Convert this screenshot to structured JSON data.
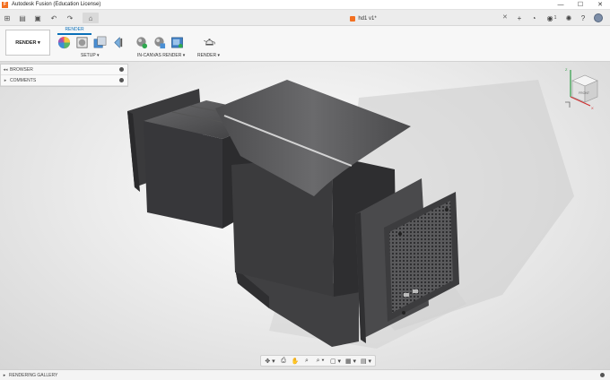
{
  "titlebar": {
    "title": "Autodesk Fusion (Education License)",
    "app_icon_letter": "F",
    "minimize": "—",
    "maximize": "☐",
    "close": "✕"
  },
  "tabbar": {
    "grid_icon": "⊞",
    "file_icon": "▤",
    "save_icon": "▣",
    "undo_icon": "↶",
    "redo_icon": "↷",
    "home_icon": "⌂",
    "document_tab": "hd1 v1*",
    "tab_close": "✕",
    "new_tab": "+",
    "job_status": "◔",
    "notifications_count": "1",
    "extensions_icon": "✺",
    "help_icon": "?"
  },
  "toolbar": {
    "workspace": "RENDER ▾",
    "active_tab": "RENDER",
    "groups": [
      {
        "label": "SETUP ▾"
      },
      {
        "label": "IN-CANVAS RENDER ▾"
      },
      {
        "label": "RENDER ▾"
      }
    ]
  },
  "browser": {
    "items": [
      {
        "label": "BROWSER",
        "chev": "◂◂"
      },
      {
        "label": "COMMENTS",
        "chev": "▸"
      }
    ]
  },
  "viewcube": {
    "face_label": "FRONT",
    "axis_z": "Z",
    "axis_x": "X"
  },
  "navbar": {
    "tools": [
      "✥ ▾",
      "⎙",
      "✋",
      "⌕",
      "⌕ ▾",
      "▢ ▾",
      "▦ ▾",
      "▤ ▾"
    ]
  },
  "statusbar": {
    "chev": "▸",
    "label": "RENDERING GALLERY"
  },
  "colors": {
    "brand": "#f37021",
    "accent": "#0a6fb8",
    "model_dark": "#3a3a3c"
  }
}
